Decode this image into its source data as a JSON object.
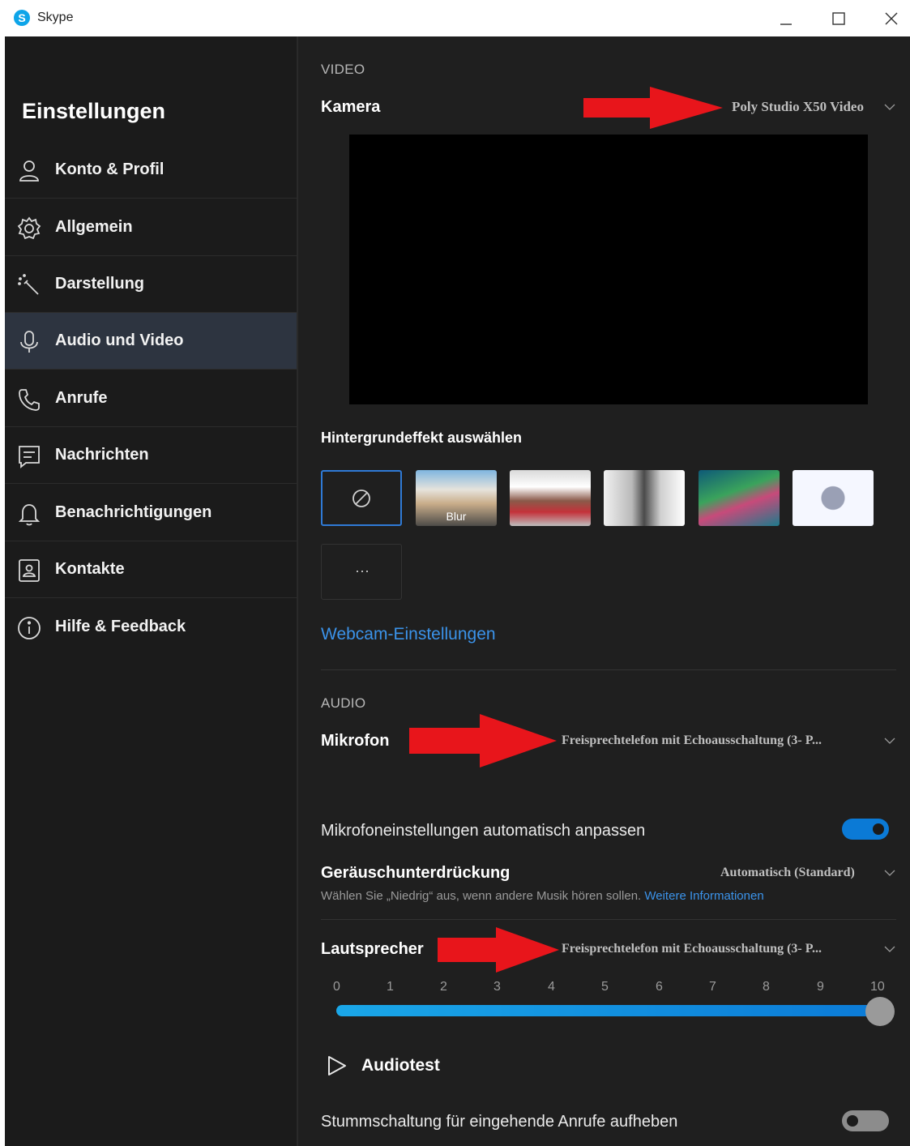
{
  "window": {
    "title": "Skype"
  },
  "sidebar": {
    "title": "Einstellungen",
    "active_index": 3,
    "items": [
      {
        "label": "Konto & Profil",
        "icon": "person-icon"
      },
      {
        "label": "Allgemein",
        "icon": "gear-icon"
      },
      {
        "label": "Darstellung",
        "icon": "magic-wand-icon"
      },
      {
        "label": "Audio und Video",
        "icon": "microphone-icon"
      },
      {
        "label": "Anrufe",
        "icon": "phone-icon"
      },
      {
        "label": "Nachrichten",
        "icon": "message-icon"
      },
      {
        "label": "Benachrichtigungen",
        "icon": "bell-icon"
      },
      {
        "label": "Kontakte",
        "icon": "contacts-icon"
      },
      {
        "label": "Hilfe & Feedback",
        "icon": "info-icon"
      }
    ]
  },
  "video": {
    "heading": "VIDEO",
    "camera_label": "Kamera",
    "camera_value": "Poly Studio X50 Video",
    "background_title": "Hintergrundeffekt auswählen",
    "blur_label": "Blur",
    "more_label": "···",
    "webcam_link": "Webcam-Einstellungen"
  },
  "audio": {
    "heading": "AUDIO",
    "mic_label": "Mikrofon",
    "mic_value": "Freisprechtelefon mit Echoausschaltung (3- P...",
    "auto_adjust_label": "Mikrofoneinstellungen automatisch anpassen",
    "auto_adjust_on": true,
    "noise_label": "Geräuschunterdrückung",
    "noise_value": "Automatisch (Standard)",
    "noise_hint": "Wählen Sie „Niedrig“ aus, wenn andere Musik hören sollen.",
    "noise_link": "Weitere Informationen",
    "speaker_label": "Lautsprecher",
    "speaker_value": "Freisprechtelefon mit Echoausschaltung (3- P...",
    "volume_ticks": [
      "0",
      "1",
      "2",
      "3",
      "4",
      "5",
      "6",
      "7",
      "8",
      "9",
      "10"
    ],
    "volume_value": 10,
    "audiotest_label": "Audiotest",
    "unmute_label": "Stummschaltung für eingehende Anrufe aufheben",
    "unmute_on": false
  },
  "colors": {
    "accent": "#0b7ad6",
    "link": "#3b93ea",
    "annotation_arrow": "#e8151b"
  }
}
